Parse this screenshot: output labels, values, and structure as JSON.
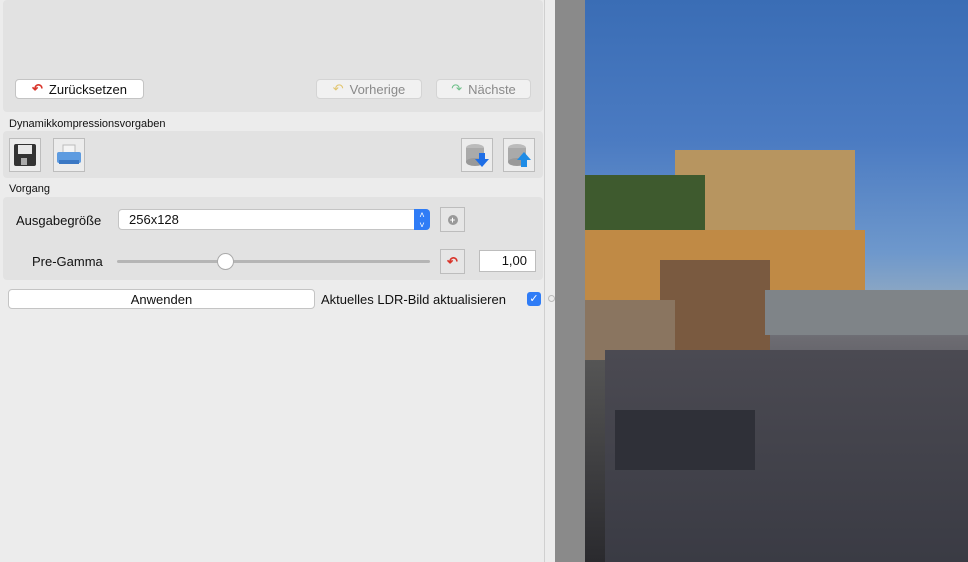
{
  "nav": {
    "reset": "Zurücksetzen",
    "prev": "Vorherige",
    "next": "Nächste"
  },
  "presets": {
    "title": "Dynamikkompressionsvorgaben"
  },
  "process": {
    "title": "Vorgang",
    "output_size_label": "Ausgabegröße",
    "output_size_value": "256x128",
    "pregamma_label": "Pre-Gamma",
    "pregamma_value": "1,00",
    "pregamma_slider_fraction": 0.33
  },
  "apply": {
    "label": "Anwenden",
    "update_ldr_label": "Aktuelles LDR-Bild aktualisieren",
    "update_ldr_checked": true
  },
  "colors": {
    "accent": "#2f7cf6",
    "undo": "#d9352b"
  }
}
